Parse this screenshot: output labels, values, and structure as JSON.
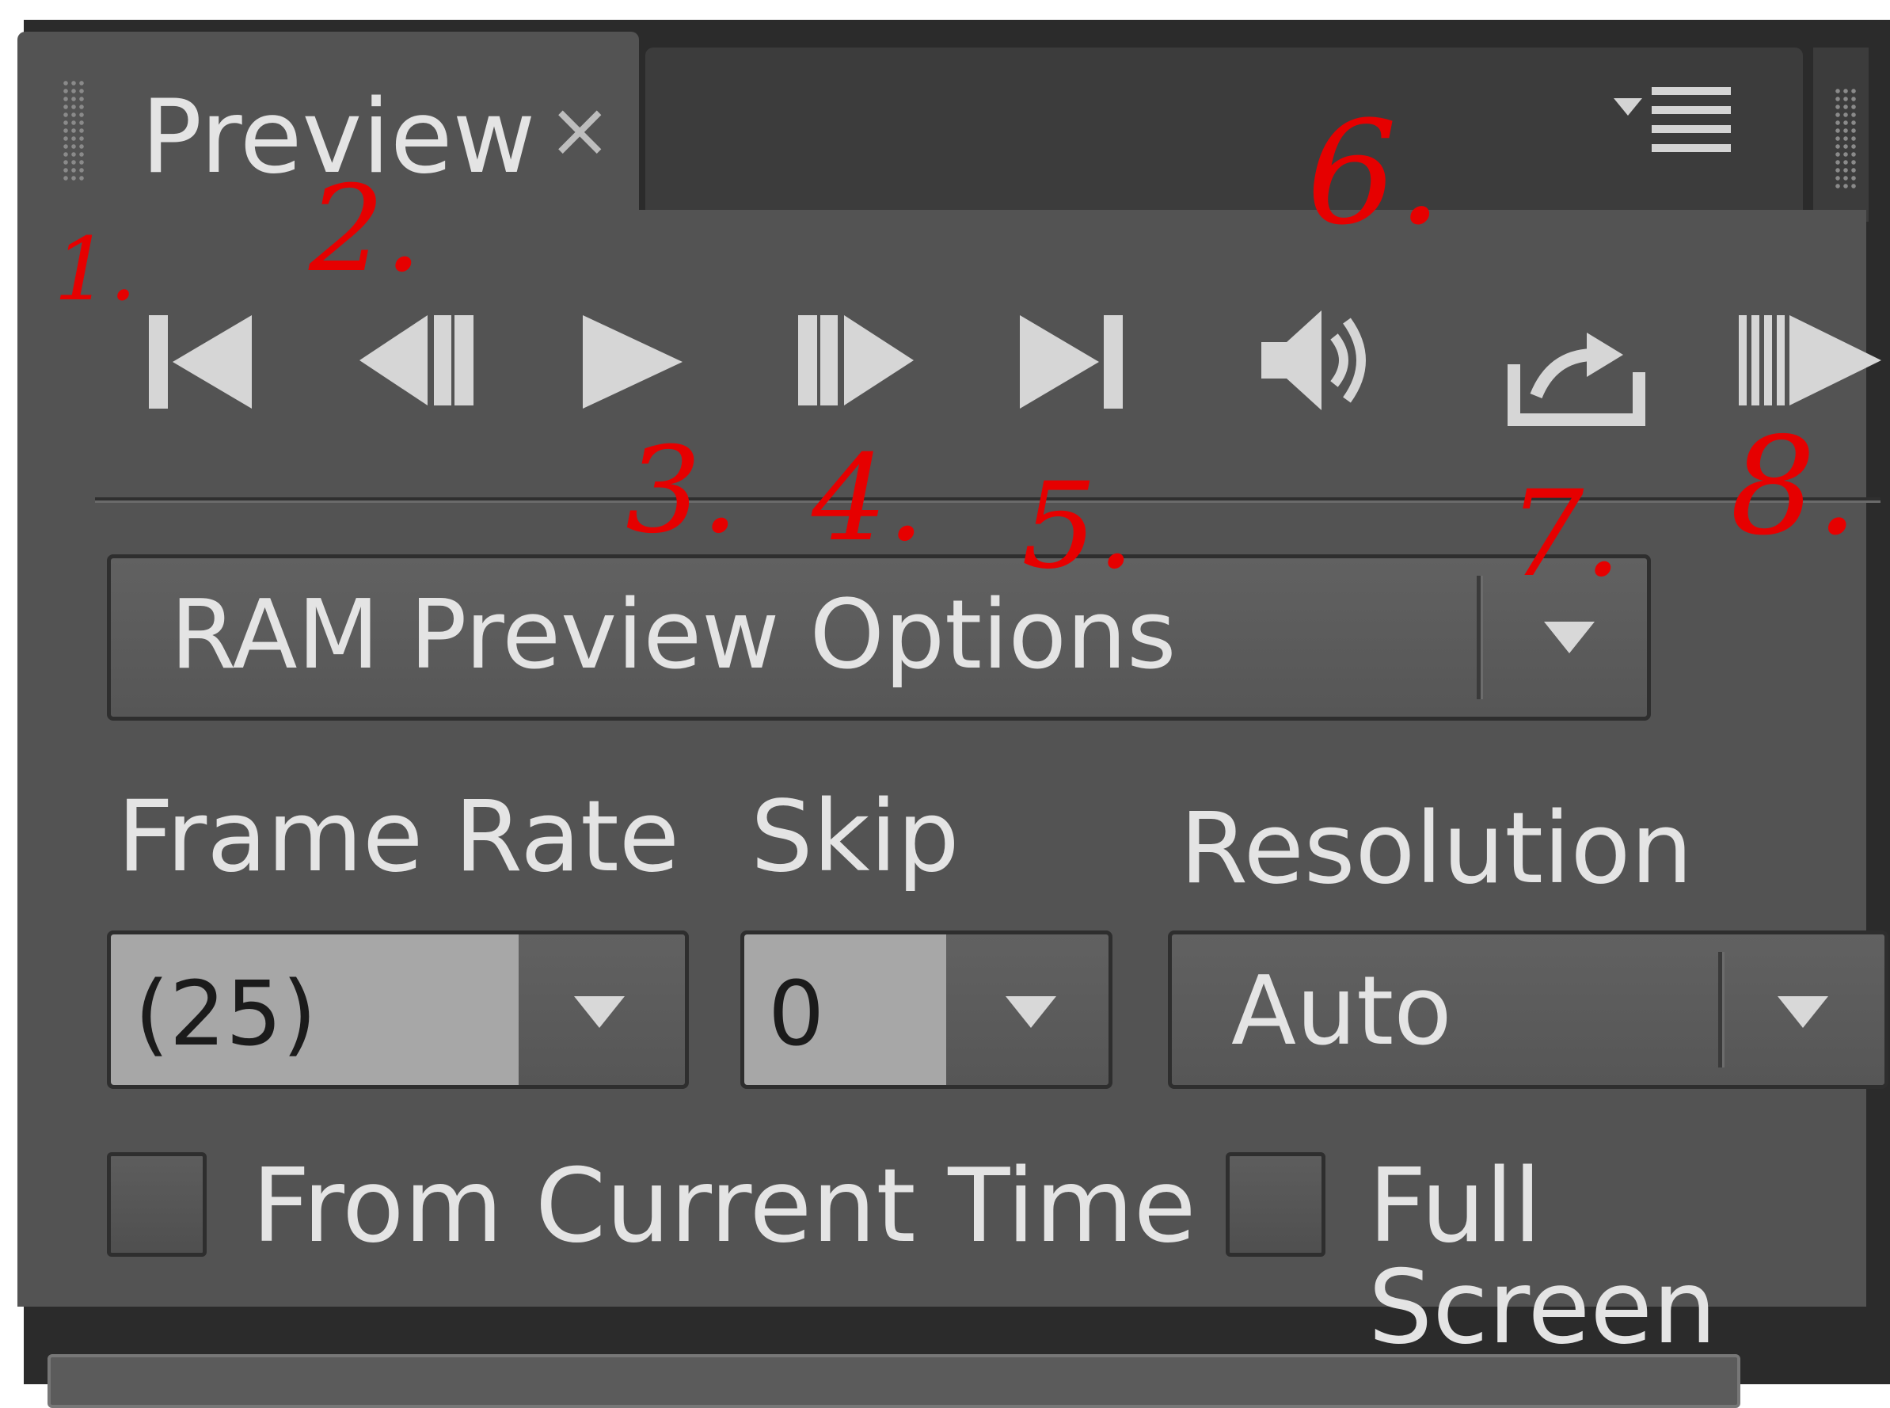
{
  "panel": {
    "tab_title": "Preview",
    "tab_close_symbol": "×",
    "panel_menu_icon": "panel-menu-icon"
  },
  "controls": [
    {
      "name": "first-frame-button",
      "icon": "skip-to-first-frame-icon"
    },
    {
      "name": "previous-frame-button",
      "icon": "step-backward-icon"
    },
    {
      "name": "play-pause-button",
      "icon": "play-icon"
    },
    {
      "name": "next-frame-button",
      "icon": "step-forward-icon"
    },
    {
      "name": "last-frame-button",
      "icon": "skip-to-last-frame-icon"
    },
    {
      "name": "mute-audio-button",
      "icon": "speaker-icon"
    },
    {
      "name": "loop-options-button",
      "icon": "loop-icon"
    },
    {
      "name": "ram-preview-button",
      "icon": "ram-preview-icon"
    }
  ],
  "annotations": [
    "1.",
    "2.",
    "3.",
    "4.",
    "5.",
    "6.",
    "7.",
    "8."
  ],
  "options": {
    "dropdown_label": "RAM Preview Options",
    "frame_rate_label": "Frame Rate",
    "frame_rate_value": "(25)",
    "skip_label": "Skip",
    "skip_value": "0",
    "resolution_label": "Resolution",
    "resolution_value": "Auto",
    "from_current_time_label": "From Current Time",
    "full_screen_label": "Full Screen"
  },
  "colors": {
    "panel_bg": "#535353",
    "frame_bg": "#2b2b2b",
    "annotation_red": "#e60000",
    "text": "#e4e4e4"
  }
}
